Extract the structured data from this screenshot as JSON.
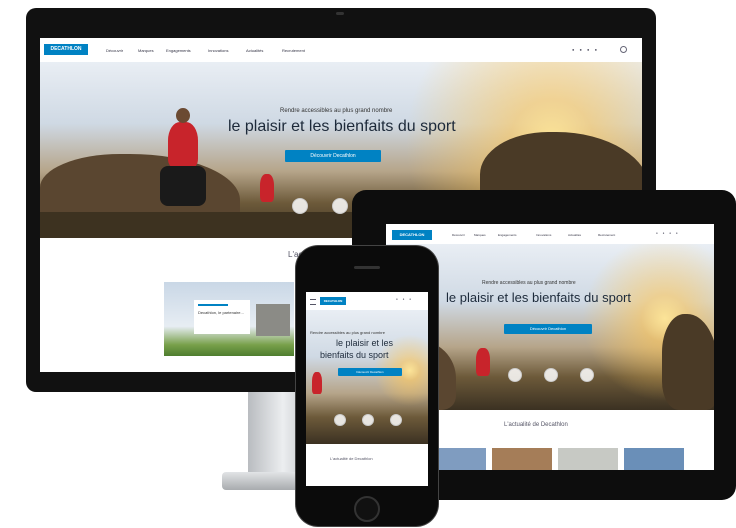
{
  "brand": {
    "logo": "DECATHLON",
    "accent": "#0082c3"
  },
  "nav": {
    "items": [
      "Découvrir",
      "Marques",
      "Engagements",
      "Innovations",
      "Actualités",
      "Recrutement"
    ]
  },
  "hero": {
    "subtitle": "Rendre accessibles au plus grand nombre",
    "title": "le plaisir et les bienfaits du sport",
    "mobile_title_l1": "le plaisir et les",
    "mobile_title_l2": "bienfaits du sport",
    "cta": "Découvrir Decathlon"
  },
  "desktop": {
    "section_title": "L'actualité",
    "card_title": "Decathlon, le partenaire..."
  },
  "tablet": {
    "section_title": "L'actualité de Decathlon"
  },
  "phone": {
    "section_title": "L'actualité de Decathlon"
  },
  "icons": [
    "devices-icon",
    "shield-icon",
    "globe-icon"
  ]
}
